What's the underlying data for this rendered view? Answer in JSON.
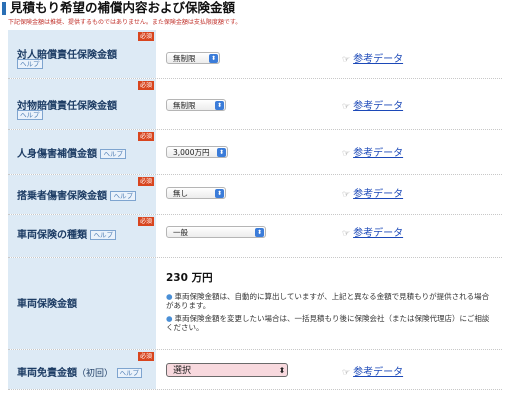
{
  "header": {
    "title": "見積もり希望の補償内容および保険金額",
    "note": "下記保険金額は推奨、提供するものではありません。また保険金額は支払限度額です。"
  },
  "badges": {
    "required": "必須",
    "help": "ヘルプ"
  },
  "reference_link": "参考データ",
  "rows": [
    {
      "label": "対人賠償責任保険金額",
      "value": "無制限"
    },
    {
      "label": "対物賠償責任保険金額",
      "value": "無制限"
    },
    {
      "label": "人身傷害補償金額",
      "value": "3,000万円"
    },
    {
      "label": "搭乗者傷害保険金額",
      "value": "無し"
    },
    {
      "label": "車両保険の種類",
      "value": "一般"
    },
    {
      "label": "車両保険金額",
      "amount": "230 万円",
      "bullets": [
        "車両保険金額は、自動的に算出していますが、上記と異なる金額で見積もりが提供される場合があります。",
        "車両保険金額を変更したい場合は、一括見積もり後に保険会社（または保険代理店）にご相談ください。"
      ]
    },
    {
      "label": "車両免責金額",
      "label_sub": "（初回）",
      "value": "選択"
    }
  ]
}
